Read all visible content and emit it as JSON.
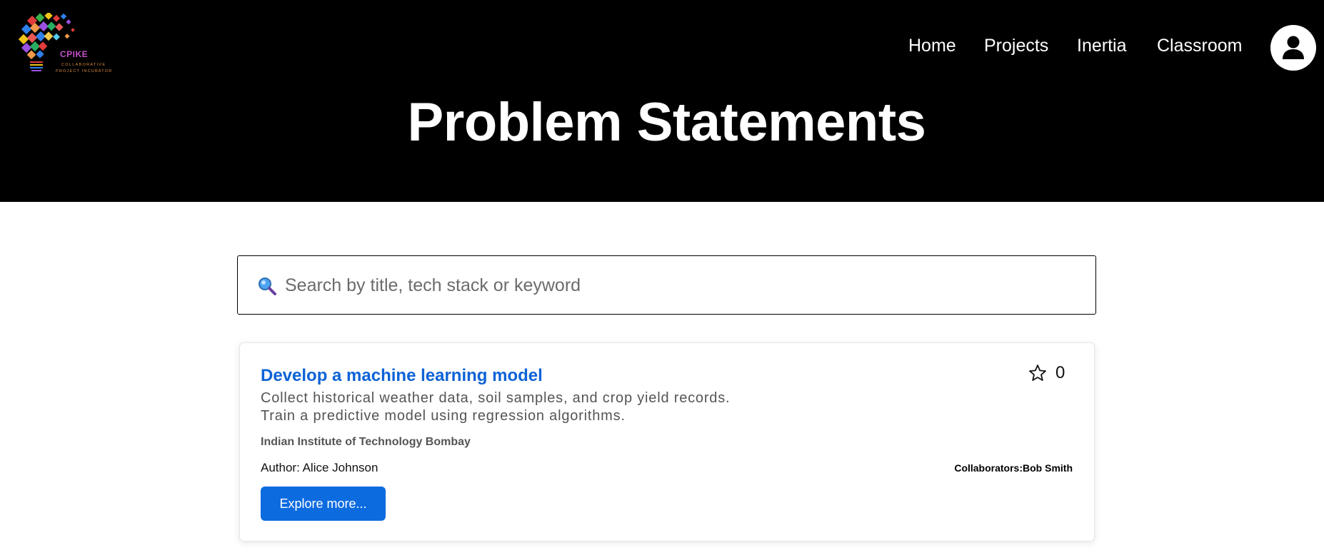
{
  "logo": {
    "brand": "CPIKE",
    "tagline_line1": "COLLABORATIVE",
    "tagline_line2": "PROJECT INCUBATOR"
  },
  "nav": {
    "items": [
      {
        "label": "Home"
      },
      {
        "label": "Projects"
      },
      {
        "label": "Inertia"
      },
      {
        "label": "Classroom"
      }
    ],
    "avatar_icon": "user-icon"
  },
  "page": {
    "title": "Problem Statements"
  },
  "search": {
    "icon": "search-icon",
    "placeholder": "Search by title, tech stack or keyword",
    "value": ""
  },
  "cards": [
    {
      "title": "Develop a machine learning model",
      "description": "Collect historical weather data, soil samples, and crop yield records. Train a predictive model using regression algorithms.",
      "institution": "Indian Institute of Technology Bombay",
      "author": "Author: Alice Johnson",
      "collaborators": "Collaborators:Bob Smith",
      "button_label": "Explore more...",
      "star_icon": "star-icon",
      "star_count": "0"
    }
  ],
  "colors": {
    "header_bg": "#000000",
    "accent": "#0d63d6",
    "button_bg": "#0d6be0"
  }
}
